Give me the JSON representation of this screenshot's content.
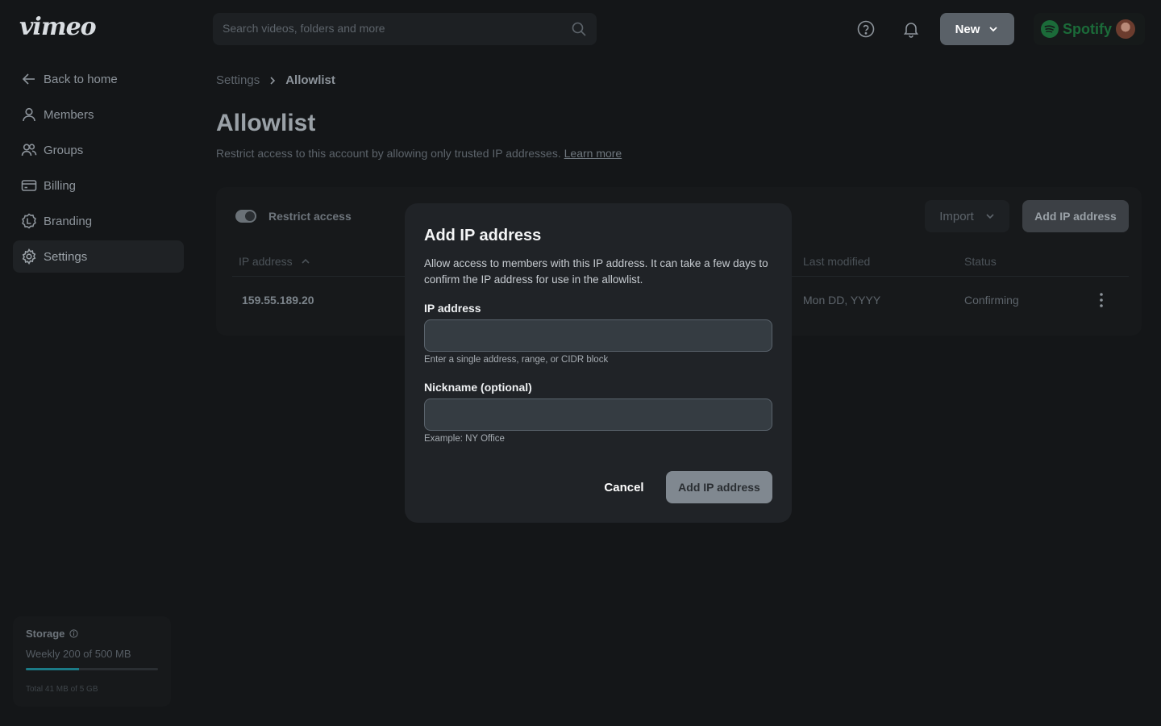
{
  "topbar": {
    "logo": "vimeo",
    "search": {
      "placeholder": "Search videos, folders and more"
    },
    "new_label": "New",
    "team_name": "Spotify",
    "icons": [
      "search-icon",
      "help-icon",
      "bell-icon",
      "chevron-down-icon",
      "spotify-logo-icon"
    ]
  },
  "sidebar": {
    "items": [
      {
        "label": "Back to home",
        "icon": "arrow-left-icon"
      },
      {
        "label": "Members",
        "icon": "user-icon"
      },
      {
        "label": "Groups",
        "icon": "users-icon"
      },
      {
        "label": "Billing",
        "icon": "credit-card-icon"
      },
      {
        "label": "Branding",
        "icon": "branding-icon"
      },
      {
        "label": "Settings",
        "icon": "gear-icon",
        "active": true
      }
    ],
    "storage": {
      "title": "Storage",
      "weekly": "Weekly 200 of 500 MB",
      "weekly_fraction": 0.4,
      "total": "Total 41 MB of 5 GB"
    }
  },
  "breadcrumb": {
    "parent": "Settings",
    "current": "Allowlist"
  },
  "page": {
    "title": "Allowlist",
    "subtitle": "Restrict access to this account by allowing only trusted IP addresses.",
    "learn_more": "Learn more"
  },
  "card": {
    "toggle_label": "Restrict access",
    "toggle_on": true,
    "import_label": "Import",
    "add_label": "Add IP address",
    "columns": {
      "ip": "IP address",
      "last_modified": "Last modified",
      "status": "Status"
    },
    "rows": [
      {
        "ip": "159.55.189.20",
        "last_modified": "Mon DD, YYYY",
        "status": "Confirming"
      }
    ]
  },
  "modal": {
    "title": "Add IP address",
    "description": "Allow access to members with this IP address. It can take a few days to confirm the IP address for use in the allowlist.",
    "ip_label": "IP address",
    "ip_value": "",
    "ip_help": "Enter a single address, range, or CIDR block",
    "nickname_label": "Nickname (optional)",
    "nickname_value": "",
    "nickname_help": "Example: NY Office",
    "cancel_label": "Cancel",
    "submit_label": "Add IP address"
  },
  "colors": {
    "background": "#141618",
    "modal": "#202327",
    "input": "#353c42",
    "brand_green": "#1b6b39",
    "storage_fill": "#1b7a86"
  }
}
